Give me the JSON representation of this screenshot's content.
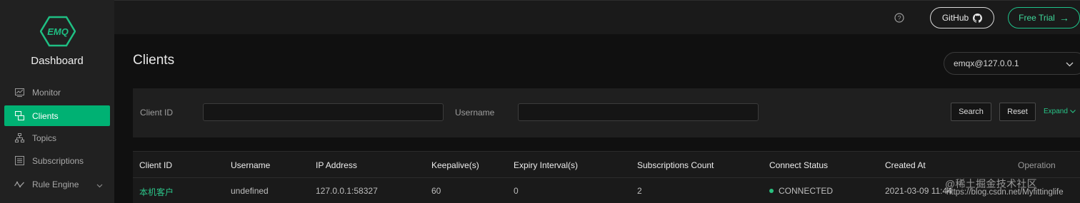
{
  "brand": {
    "logo_text": "EMQ",
    "name": "Dashboard"
  },
  "sidebar": {
    "items": [
      {
        "label": "Monitor",
        "icon": "monitor-icon"
      },
      {
        "label": "Clients",
        "icon": "clients-icon",
        "active": true
      },
      {
        "label": "Topics",
        "icon": "topics-icon"
      },
      {
        "label": "Subscriptions",
        "icon": "subscriptions-icon"
      },
      {
        "label": "Rule Engine",
        "icon": "rule-engine-icon",
        "expandable": true
      }
    ]
  },
  "topbar": {
    "github_label": "GitHub",
    "trial_label": "Free Trial"
  },
  "page": {
    "title": "Clients",
    "node": "emqx@127.0.0.1"
  },
  "filter": {
    "client_id_label": "Client ID",
    "client_id_value": "",
    "username_label": "Username",
    "username_value": "",
    "search_label": "Search",
    "reset_label": "Reset",
    "expand_label": "Expand"
  },
  "table": {
    "columns": [
      "Client ID",
      "Username",
      "IP Address",
      "Keepalive(s)",
      "Expiry Interval(s)",
      "Subscriptions Count",
      "Connect Status",
      "Created At",
      "Operation"
    ],
    "rows": [
      {
        "client_id": "本机客户",
        "username": "undefined",
        "ip": "127.0.0.1:58327",
        "keepalive": "60",
        "expiry": "0",
        "subscriptions": "2",
        "status": "CONNECTED",
        "created_at": "2021-03-09 11:44"
      }
    ]
  },
  "watermark": {
    "line1": "@稀土掘金技术社区",
    "line2": "https://blog.csdn.net/Myfittinglife"
  },
  "colors": {
    "accent": "#00b173",
    "background": "#101010",
    "sidebar": "#212121"
  }
}
